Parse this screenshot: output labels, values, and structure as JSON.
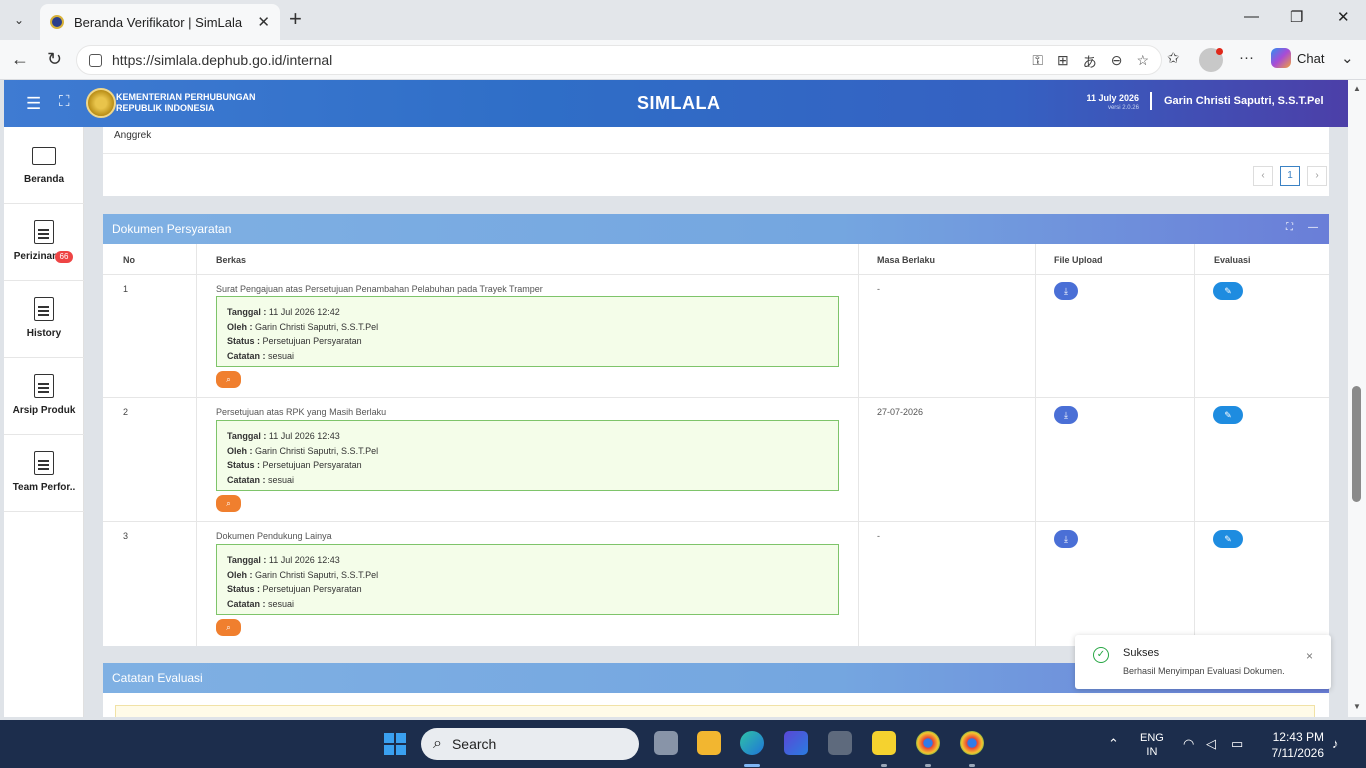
{
  "browser": {
    "tab_title": "Beranda Verifikator | SimLala",
    "url": "https://simlala.dephub.go.id/internal",
    "chat_label": "Chat"
  },
  "header": {
    "org_line1": "KEMENTERIAN PERHUBUNGAN",
    "org_line2": "REPUBLIK INDONESIA",
    "app_title": "SIMLALA",
    "date": "11 July 2026",
    "version": "versi 2.0.26",
    "user": "Garin Christi Saputri, S.S.T.Pel"
  },
  "sidebar": {
    "items": [
      {
        "label": "Beranda",
        "icon": "monitor-icon"
      },
      {
        "label": "Perizinan",
        "icon": "document-icon",
        "badge": "66"
      },
      {
        "label": "History",
        "icon": "document-icon"
      },
      {
        "label": "Arsip Produk",
        "icon": "document-icon"
      },
      {
        "label": "Team Perfor..",
        "icon": "document-icon"
      }
    ]
  },
  "top_card": {
    "row_text": "Anggrek",
    "pagination": {
      "prev": "‹",
      "current": "1",
      "next": "›"
    }
  },
  "documents": {
    "title": "Dokumen Persyaratan",
    "columns": [
      "No",
      "Berkas",
      "Masa Berlaku",
      "File Upload",
      "Evaluasi"
    ],
    "labels": {
      "tanggal": "Tanggal :",
      "oleh": "Oleh :",
      "status": "Status :",
      "catatan": "Catatan :"
    },
    "rows": [
      {
        "no": "1",
        "berkas": "Surat Pengajuan atas Persetujuan Penambahan Pelabuhan pada Trayek Tramper",
        "tanggal": "11 Jul 2026 12:42",
        "oleh": "Garin Christi Saputri, S.S.T.Pel",
        "status": "Persetujuan Persyaratan",
        "catatan": "sesuai",
        "masa_berlaku": "-"
      },
      {
        "no": "2",
        "berkas": "Persetujuan atas RPK yang Masih Berlaku",
        "tanggal": "11 Jul 2026 12:43",
        "oleh": "Garin Christi Saputri, S.S.T.Pel",
        "status": "Persetujuan Persyaratan",
        "catatan": "sesuai",
        "masa_berlaku": "27-07-2026"
      },
      {
        "no": "3",
        "berkas": "Dokumen Pendukung Lainya",
        "tanggal": "11 Jul 2026 12:43",
        "oleh": "Garin Christi Saputri, S.S.T.Pel",
        "status": "Persetujuan Persyaratan",
        "catatan": "sesuai",
        "masa_berlaku": "-"
      }
    ]
  },
  "evaluation": {
    "title": "Catatan Evaluasi"
  },
  "toast": {
    "title": "Sukses",
    "message": "Berhasil Menyimpan Evaluasi Dokumen.",
    "close": "×"
  },
  "taskbar": {
    "search_placeholder": "Search",
    "lang_line1": "ENG",
    "lang_line2": "IN",
    "time": "12:43 PM",
    "date": "7/11/2026"
  }
}
